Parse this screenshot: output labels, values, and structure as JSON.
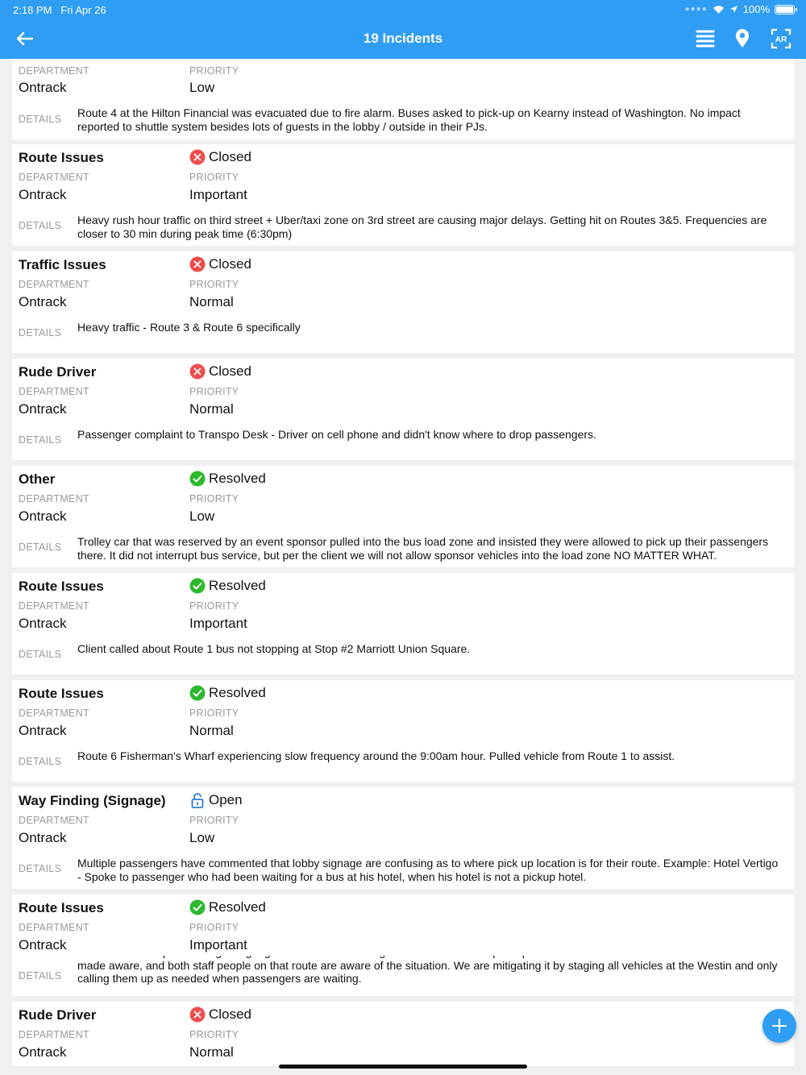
{
  "status_bar": {
    "time": "2:18 PM",
    "date": "Fri Apr 26",
    "battery": "100%"
  },
  "nav": {
    "title": "19 Incidents",
    "ar_label": "AR"
  },
  "labels": {
    "department": "DEPARTMENT",
    "priority": "PRIORITY",
    "details": "DETAILS"
  },
  "incidents": [
    {
      "title": "",
      "status": "",
      "department": "Ontrack",
      "priority": "Low",
      "details": "Route 4 at the Hilton Financial was evacuated due to fire alarm. Buses asked to pick-up on Kearny instead of Washington. No impact reported to shuttle system besides lots of guests in the lobby / outside in their PJs."
    },
    {
      "title": "Route Issues",
      "status": "Closed",
      "department": "Ontrack",
      "priority": "Important",
      "details": "Heavy rush hour traffic on third street + Uber/taxi zone on 3rd street are causing major delays.  Getting hit on Routes 3&5. Frequencies are closer to 30 min during peak time (6:30pm)"
    },
    {
      "title": "Traffic Issues",
      "status": "Closed",
      "department": "Ontrack",
      "priority": "Normal",
      "details": "Heavy traffic - Route 3 & Route 6 specifically"
    },
    {
      "title": "Rude Driver",
      "status": "Closed",
      "department": "Ontrack",
      "priority": "Normal",
      "details": "Passenger complaint to Transpo Desk - Driver on cell phone and didn't know where to drop passengers."
    },
    {
      "title": "Other",
      "status": "Resolved",
      "department": "Ontrack",
      "priority": "Low",
      "details": "Trolley car that was reserved by an event sponsor pulled into the bus load zone and insisted they were allowed to pick up their passengers there.  It did not interrupt bus service, but per the client we will not allow sponsor vehicles into the load zone NO MATTER WHAT."
    },
    {
      "title": "Route Issues",
      "status": "Resolved",
      "department": "Ontrack",
      "priority": "Important",
      "details": "Client called about Route 1 bus not stopping at Stop #2 Marriott Union Square."
    },
    {
      "title": "Route Issues",
      "status": "Resolved",
      "department": "Ontrack",
      "priority": "Normal",
      "details": "Route 6 Fisherman's Wharf experiencing slow frequency around the 9:00am hour.  Pulled vehicle from Route 1 to assist."
    },
    {
      "title": "Way Finding (Signage)",
      "status": "Open",
      "department": "Ontrack",
      "priority": "Low",
      "details": "Multiple passengers have commented that lobby signage are confusing as to where pick up location is for their route.  Example:  Hotel Vertigo - Spoke to passenger who had been waiting for a bus at his hotel, when his hotel is not a pickup hotel."
    },
    {
      "title": "Route Issues",
      "status": "Resolved",
      "department": "Ontrack",
      "priority": "Important",
      "details": "Marriott Union Square changed signage in their hotel insisting that buses could not pick up in white zone in front of their hotel.  Client was made aware, and both staff people on that route are aware of the situation.  We are mitigating it by staging all vehicles at the Westin and only calling them up as needed when passengers are waiting."
    },
    {
      "title": "Rude Driver",
      "status": "Closed",
      "department": "Ontrack",
      "priority": "Normal",
      "details": ""
    }
  ],
  "colors": {
    "accent": "#2f9df4",
    "closed": "#ee4d4d",
    "resolved": "#2db82d",
    "open": "#2f7fd0"
  }
}
